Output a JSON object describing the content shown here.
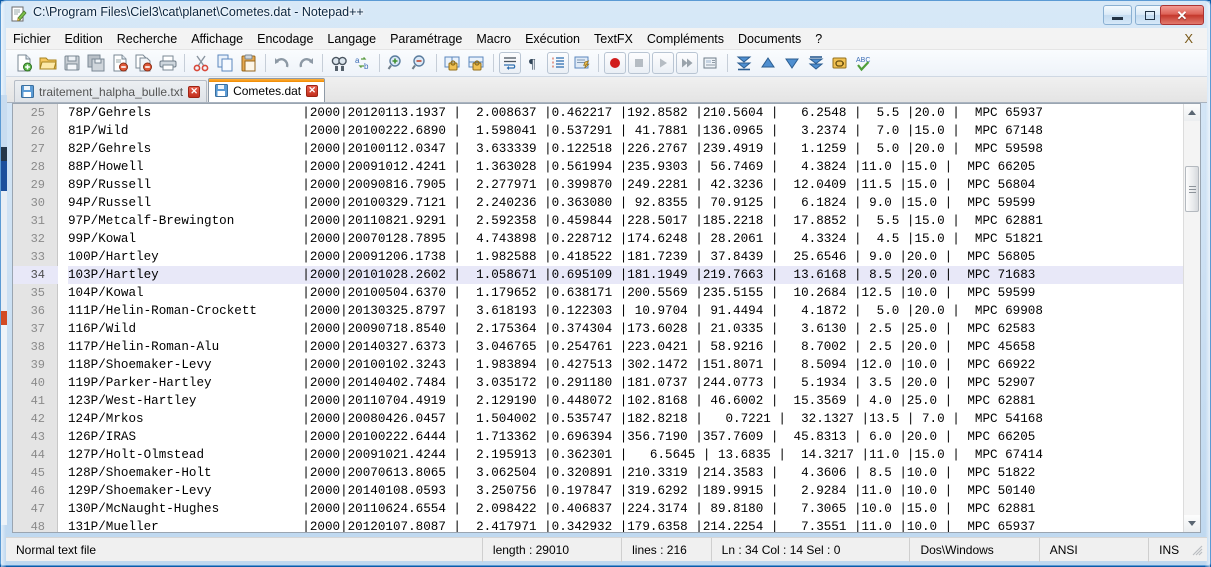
{
  "window": {
    "title": "C:\\Program Files\\Ciel3\\cat\\planet\\Cometes.dat - Notepad++",
    "icon": "notepad-plus-plus-icon",
    "minimize_label": "–",
    "maximize_label": "□",
    "close_label": "✕"
  },
  "menu": {
    "items": [
      "Fichier",
      "Edition",
      "Recherche",
      "Affichage",
      "Encodage",
      "Langage",
      "Paramétrage",
      "Macro",
      "Exécution",
      "TextFX",
      "Compléments",
      "Documents",
      "?"
    ],
    "right_close_label": "X"
  },
  "toolbar": {
    "buttons": [
      "new-file-icon",
      "open-file-icon",
      "save-icon",
      "save-all-icon",
      "close-file-icon",
      "close-all-icon",
      "print-icon",
      "sep",
      "cut-icon",
      "copy-icon",
      "paste-icon",
      "sep",
      "undo-icon",
      "redo-icon",
      "sep",
      "find-icon",
      "replace-icon",
      "sep",
      "zoom-in-icon",
      "zoom-out-icon",
      "sep",
      "sync-vertical-scroll-icon",
      "sync-horizontal-scroll-icon",
      "sep",
      "word-wrap-icon",
      "show-all-chars-icon",
      "indent-guide-icon",
      "user-language-icon",
      "sep",
      "start-record-macro-icon",
      "stop-record-macro-icon",
      "play-macro-icon",
      "run-macro-multiple-icon",
      "save-macro-icon",
      "sep",
      "first-bookmark-icon",
      "previous-bookmark-icon",
      "next-bookmark-icon",
      "last-bookmark-icon",
      "clear-bookmarks-icon",
      "spell-check-icon"
    ]
  },
  "tabs": [
    {
      "label": "traitement_halpha_bulle.txt",
      "active": false,
      "icon": "save-disk-icon",
      "close": "✕"
    },
    {
      "label": "Cometes.dat",
      "active": true,
      "icon": "save-disk-icon",
      "close": "✕"
    }
  ],
  "editor": {
    "current_line": 34,
    "lines": [
      {
        "n": "25",
        "text": "78P/Gehrels                    |2000|20120113.1937 |  2.008637 |0.462217 |192.8582 |210.5604 |   6.2548 |  5.5 |20.0 |  MPC 65937"
      },
      {
        "n": "26",
        "text": "81P/Wild                       |2000|20100222.6890 |  1.598041 |0.537291 | 41.7881 |136.0965 |   3.2374 |  7.0 |15.0 |  MPC 67148"
      },
      {
        "n": "27",
        "text": "82P/Gehrels                    |2000|20100112.0347 |  3.633339 |0.122518 |226.2767 |239.4919 |   1.1259 |  5.0 |20.0 |  MPC 59598"
      },
      {
        "n": "28",
        "text": "88P/Howell                     |2000|20091012.4241 |  1.363028 |0.561994 |235.9303 | 56.7469 |   4.3824 |11.0 |15.0 |  MPC 66205"
      },
      {
        "n": "29",
        "text": "89P/Russell                    |2000|20090816.7905 |  2.277971 |0.399870 |249.2281 | 42.3236 |  12.0409 |11.5 |15.0 |  MPC 56804"
      },
      {
        "n": "30",
        "text": "94P/Russell                    |2000|20100329.7121 |  2.240236 |0.363080 | 92.8355 | 70.9125 |   6.1824 | 9.0 |15.0 |  MPC 59599"
      },
      {
        "n": "31",
        "text": "97P/Metcalf-Brewington         |2000|20110821.9291 |  2.592358 |0.459844 |228.5017 |185.2218 |  17.8852 |  5.5 |15.0 |  MPC 62881"
      },
      {
        "n": "32",
        "text": "99P/Kowal                      |2000|20070128.7895 |  4.743898 |0.228712 |174.6248 | 28.2061 |   4.3324 |  4.5 |15.0 |  MPC 51821"
      },
      {
        "n": "33",
        "text": "100P/Hartley                   |2000|20091206.1738 |  1.982588 |0.418522 |181.7239 | 37.8439 |  25.6546 | 9.0 |20.0 |  MPC 56805"
      },
      {
        "n": "34",
        "text": "103P/Hartley                   |2000|20101028.2602 |  1.058671 |0.695109 |181.1949 |219.7663 |  13.6168 | 8.5 |20.0 |  MPC 71683"
      },
      {
        "n": "35",
        "text": "104P/Kowal                     |2000|20100504.6370 |  1.179652 |0.638171 |200.5569 |235.5155 |  10.2684 |12.5 |10.0 |  MPC 59599"
      },
      {
        "n": "36",
        "text": "111P/Helin-Roman-Crockett      |2000|20130325.8797 |  3.618193 |0.122303 | 10.9704 | 91.4494 |   4.1872 |  5.0 |20.0 |  MPC 69908"
      },
      {
        "n": "37",
        "text": "116P/Wild                      |2000|20090718.8540 |  2.175364 |0.374304 |173.6028 | 21.0335 |   3.6130 | 2.5 |25.0 |  MPC 62583"
      },
      {
        "n": "38",
        "text": "117P/Helin-Roman-Alu           |2000|20140327.6373 |  3.046765 |0.254761 |223.0421 | 58.9216 |   8.7002 | 2.5 |20.0 |  MPC 45658"
      },
      {
        "n": "39",
        "text": "118P/Shoemaker-Levy            |2000|20100102.3243 |  1.983894 |0.427513 |302.1472 |151.8071 |   8.5094 |12.0 |10.0 |  MPC 66922"
      },
      {
        "n": "40",
        "text": "119P/Parker-Hartley            |2000|20140402.7484 |  3.035172 |0.291180 |181.0737 |244.0773 |   5.1934 | 3.5 |20.0 |  MPC 52907"
      },
      {
        "n": "41",
        "text": "123P/West-Hartley              |2000|20110704.4919 |  2.129190 |0.448072 |102.8168 | 46.6002 |  15.3569 | 4.0 |25.0 |  MPC 62881"
      },
      {
        "n": "42",
        "text": "124P/Mrkos                     |2000|20080426.0457 |  1.504002 |0.535747 |182.8218 |   0.7221 |  32.1327 |13.5 | 7.0 |  MPC 54168"
      },
      {
        "n": "43",
        "text": "126P/IRAS                      |2000|20100222.6444 |  1.713362 |0.696394 |356.7190 |357.7609 |  45.8313 | 6.0 |20.0 |  MPC 66205"
      },
      {
        "n": "44",
        "text": "127P/Holt-Olmstead             |2000|20091021.4244 |  2.195913 |0.362301 |   6.5645 | 13.6835 |  14.3217 |11.0 |15.0 |  MPC 67414"
      },
      {
        "n": "45",
        "text": "128P/Shoemaker-Holt            |2000|20070613.8065 |  3.062504 |0.320891 |210.3319 |214.3583 |   4.3606 | 8.5 |10.0 |  MPC 51822"
      },
      {
        "n": "46",
        "text": "129P/Shoemaker-Levy            |2000|20140108.0593 |  3.250756 |0.197847 |319.6292 |189.9915 |   2.9284 |11.0 |10.0 |  MPC 50140"
      },
      {
        "n": "47",
        "text": "130P/McNaught-Hughes           |2000|20110624.6554 |  2.098422 |0.406837 |224.3174 | 89.8180 |   7.3065 |10.0 |15.0 |  MPC 62881"
      },
      {
        "n": "48",
        "text": "131P/Mueller                   |2000|20120107.8087 |  2.417971 |0.342932 |179.6358 |214.2254 |   7.3551 |11.0 |10.0 |  MPC 65937"
      }
    ]
  },
  "scrollbar": {
    "up_arrow": "scroll-up-arrow",
    "down_arrow": "scroll-down-arrow"
  },
  "statusbar": {
    "file_type": "Normal text file",
    "length": "length : 29010",
    "lines": "lines : 216",
    "position": "Ln : 34   Col : 14   Sel : 0",
    "eol": "Dos\\Windows",
    "encoding": "ANSI",
    "insert_mode": "INS"
  }
}
